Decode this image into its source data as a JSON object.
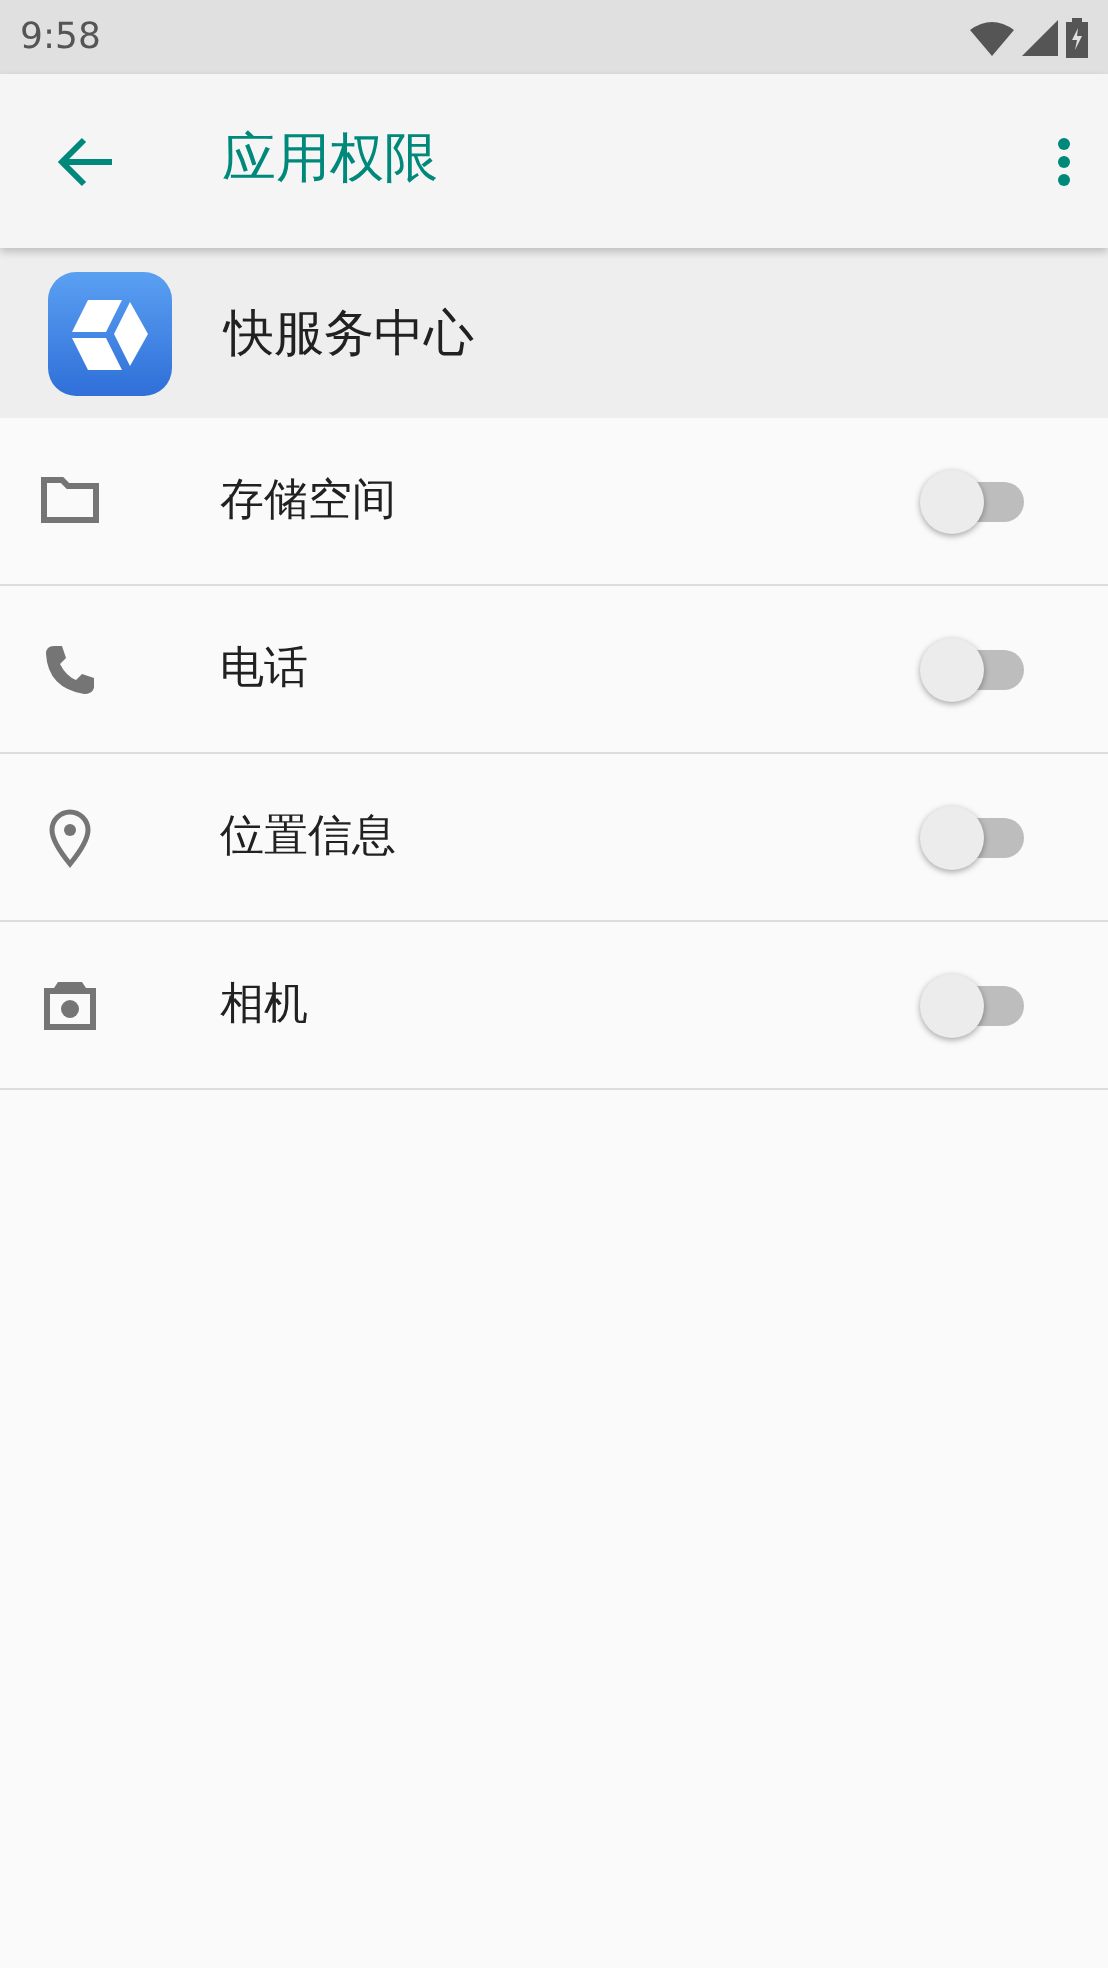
{
  "status_bar": {
    "time": "9:58"
  },
  "app_bar": {
    "title": "应用权限"
  },
  "app": {
    "name": "快服务中心"
  },
  "permissions": [
    {
      "kind": "storage",
      "label": "存储空间",
      "on": false
    },
    {
      "kind": "phone",
      "label": "电话",
      "on": false
    },
    {
      "kind": "location",
      "label": "位置信息",
      "on": false
    },
    {
      "kind": "camera",
      "label": "相机",
      "on": false
    }
  ]
}
